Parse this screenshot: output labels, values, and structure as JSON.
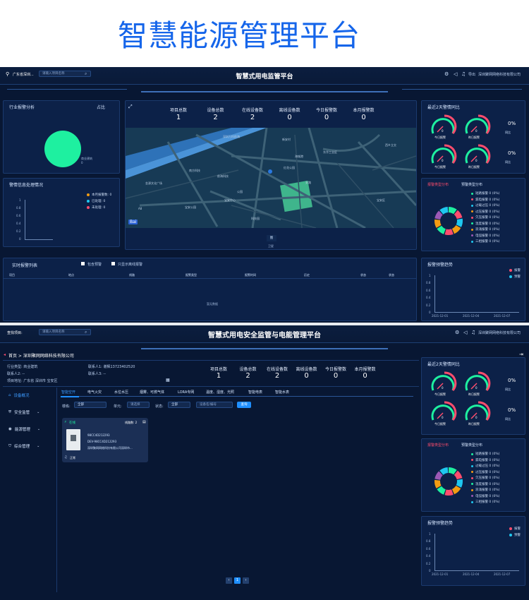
{
  "hero_title": "智慧能源管理平台",
  "colors": {
    "accent": "#1565ea",
    "bg": "#081733",
    "green": "#1ef0a0"
  },
  "screen1": {
    "location": "广东省深圳...",
    "search_placeholder": "请输入项目名称",
    "title": "智慧式用电监管平台",
    "top_right": {
      "export": "导出",
      "company": "深圳聚网网络科技有限公司"
    },
    "industry_panel": {
      "title": "行业报警分析",
      "ratio": "占比",
      "slice_label": "商业建筑",
      "slice_value": "0"
    },
    "alarm_handling": {
      "title": "警情信息处理情况",
      "legend": [
        "本月报警数: 0",
        "已处理: 0",
        "未处理: 0"
      ],
      "yticks": [
        "1",
        "0.8",
        "0.6",
        "0.4",
        "0.2",
        "0"
      ]
    },
    "stats": [
      {
        "label": "项目总数",
        "value": "1"
      },
      {
        "label": "设备总数",
        "value": "2"
      },
      {
        "label": "在线设备数",
        "value": "2"
      },
      {
        "label": "离线设备数",
        "value": "0"
      },
      {
        "label": "今日报警数",
        "value": "0"
      },
      {
        "label": "本月报警数",
        "value": "0"
      }
    ],
    "map_labels": [
      "深圳万科前海",
      "新安村",
      "海城港",
      "红花公园",
      "安路",
      "西乡立交",
      "南方科技",
      "东华工业区",
      "金源文化广场",
      "前海科技",
      "宝安中心",
      "公园",
      "科技园",
      "宝安公园",
      "A8",
      "宝安区"
    ],
    "map_buttons": [
      "图",
      "卫星"
    ],
    "recent2days": {
      "title": "最近2天警情同比",
      "gauges": [
        "今日报警",
        "昨日报警",
        "今日报警",
        "昨日报警"
      ],
      "values": [
        "0",
        "0",
        "0",
        "0"
      ],
      "percents": [
        "0%",
        "0%"
      ],
      "compare": [
        "同比",
        "同比"
      ]
    },
    "alarm_dist": {
      "tabs": [
        "报警类型分布",
        "预警类型分布"
      ],
      "items": [
        "短路报警 0 (0%)",
        "漏电报警 0 (0%)",
        "过载过压 0 (0%)",
        "过压报警 0 (0%)",
        "欠压报警 0 (0%)",
        "温度报警 0 (0%)",
        "浪涌报警 0 (0%)",
        "电弧报警 0 (0%)",
        "三相报警 0 (0%)"
      ]
    },
    "realtime_list": {
      "title": "实时报警列表",
      "checks": [
        "包含预警",
        "只显示离线报警"
      ],
      "headers": [
        "项目",
        "地点",
        "线路",
        "报警类型",
        "报警时间",
        "历史",
        "状态",
        "状态"
      ],
      "empty": "暂无数据"
    },
    "trend": {
      "title": "报警预警趋势",
      "legend": [
        "报警",
        "预警"
      ],
      "yticks": [
        "1",
        "0.8",
        "0.6",
        "0.4",
        "0.2",
        "0"
      ],
      "xticks": [
        "2021-12-01",
        "2021-12-04",
        "2021-12-07"
      ]
    }
  },
  "screen2": {
    "search_label": "查找项目:",
    "search_placeholder": "请输入项目名称",
    "title": "智慧式用电安全监管与电能管理平台",
    "top_right": {
      "company": "深圳聚网网络科技有限公司"
    },
    "breadcrumb": "首页 > 深圳聚网网络科技有限公司",
    "info": {
      "industry": "行业类型: 商业建筑",
      "contact1": "联系人1: 谢枫13723402520",
      "contact2": "联系人2: --",
      "contact3": "联系人3: --",
      "address": "项目地址: 广东省 深圳市 宝安区"
    },
    "stats": [
      {
        "label": "项目总数",
        "value": "1"
      },
      {
        "label": "设备总数",
        "value": "2"
      },
      {
        "label": "在线设备数",
        "value": "2"
      },
      {
        "label": "离线设备数",
        "value": "0"
      },
      {
        "label": "今日报警数",
        "value": "0"
      },
      {
        "label": "本月报警数",
        "value": "0"
      }
    ],
    "nav": [
      "设备概况",
      "安全监管",
      "能源管理",
      "综合管理"
    ],
    "tabs": [
      "智能空开",
      "电气火灾",
      "水位水压",
      "烟雾、可燃气体",
      "LORA专网",
      "温度、湿度、光照",
      "智能电表",
      "智能水表"
    ],
    "filters": {
      "floor_label": "楼栋:",
      "floor_val": "全部",
      "unit_label": "单元:",
      "unit_val": "请选择",
      "status_label": "状态:",
      "status_val": "全部",
      "device_ph": "设备名/编号",
      "query": "查询"
    },
    "device": {
      "status": "在线",
      "lines": "线路数: 2",
      "id1": "98CC4D212293",
      "id2": "DEV-98CC4D212293",
      "company": "深圳聚网网络科技有限公司深圳市...",
      "state": "正常"
    },
    "pagination": [
      "‹",
      "1",
      "›"
    ],
    "recent2days": {
      "title": "最近2天警情同比",
      "gauges": [
        "今日报警",
        "昨日报警",
        "今日报警",
        "昨日报警"
      ],
      "values": [
        "0",
        "0",
        "0",
        "0"
      ],
      "percents": [
        "0%",
        "0%"
      ],
      "compare": [
        "同比",
        "同比"
      ]
    },
    "alarm_dist": {
      "tabs": [
        "报警类型分布",
        "预警类型分布"
      ],
      "items": [
        "短路报警 0 (0%)",
        "漏电报警 0 (0%)",
        "过载过压 0 (0%)",
        "过压报警 0 (0%)",
        "欠压报警 0 (0%)",
        "温度报警 0 (0%)",
        "浪涌报警 0 (0%)",
        "电弧报警 0 (0%)",
        "三相报警 0 (0%)"
      ]
    },
    "trend": {
      "title": "报警预警趋势",
      "legend": [
        "报警",
        "预警"
      ],
      "yticks": [
        "1",
        "0.8",
        "0.6",
        "0.4",
        "0.2",
        "0"
      ],
      "xticks": [
        "2021-12-01",
        "2021-12-04",
        "2021-12-07"
      ]
    }
  }
}
